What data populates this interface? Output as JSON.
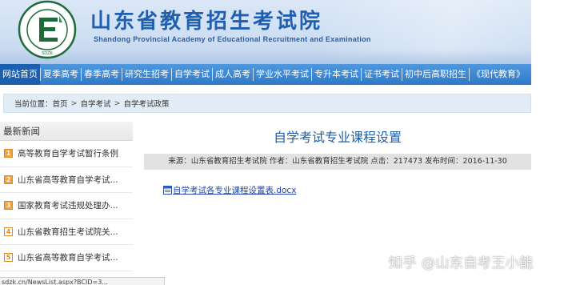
{
  "header": {
    "title": "山东省教育招生考试院",
    "subtitle": "Shandong Provincial Academy of Educational Recruitment and Examination",
    "logo_text": "Shandong Provincial Academy",
    "brand_color": "#1f5fb0"
  },
  "nav": {
    "items": [
      {
        "label": "网站首页",
        "active": true
      },
      {
        "label": "夏季高考"
      },
      {
        "label": "春季高考"
      },
      {
        "label": "研究生招考"
      },
      {
        "label": "自学考试"
      },
      {
        "label": "成人高考"
      },
      {
        "label": "学业水平考试"
      },
      {
        "label": "专升本考试"
      },
      {
        "label": "证书考试"
      },
      {
        "label": "初中后高职招生"
      },
      {
        "label": "《现代教育》"
      }
    ]
  },
  "breadcrumb": {
    "prefix": "当前位置：",
    "items": [
      "首页",
      "自学考试",
      "自学考试政策"
    ],
    "separator": ">"
  },
  "sidebar": {
    "heading": "最新新闻",
    "items": [
      {
        "num": "1",
        "text": "高等教育自学考试暂行条例"
      },
      {
        "num": "2",
        "text": "山东省高等教育自学考试..."
      },
      {
        "num": "3",
        "text": "国家教育考试违规处理办..."
      },
      {
        "num": "4",
        "text": "山东省教育招生考试院关..."
      },
      {
        "num": "5",
        "text": "山东省高等教育自学考试..."
      }
    ]
  },
  "article": {
    "title": "自学考试专业课程设置",
    "meta": "来源：山东省教育招生考试院 作者：山东省教育招生考试院 点击：217473 发布时间：2016-11-30",
    "attachment": "自学考试各专业课程设置表.docx"
  },
  "status_url": "sdzk.cn/NewsList.aspx?BCID=3...",
  "watermark": "知乎 @山东自考王小能"
}
